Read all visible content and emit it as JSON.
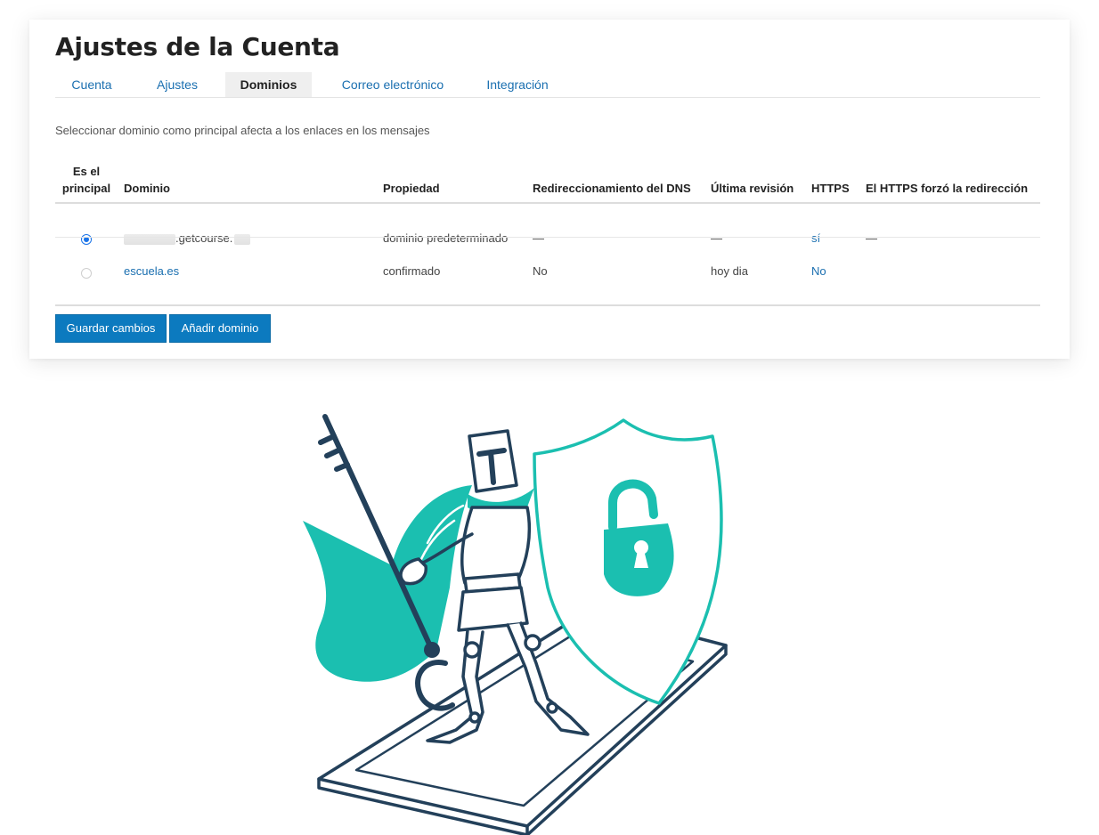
{
  "page": {
    "title": "Ajustes de la Cuenta"
  },
  "tabs": [
    {
      "label": "Cuenta",
      "active": false
    },
    {
      "label": "Ajustes",
      "active": false
    },
    {
      "label": "Dominios",
      "active": true
    },
    {
      "label": "Correo electrónico",
      "active": false
    },
    {
      "label": "Integración",
      "active": false
    }
  ],
  "description": "Seleccionar dominio como principal afecta a los enlaces en los mensajes",
  "table": {
    "headers": {
      "primary_line1": "Es el",
      "primary_line2": "principal",
      "domain": "Dominio",
      "property": "Propiedad",
      "dns": "Redireccionamiento del DNS",
      "last_check": "Última revisión",
      "https": "HTTPS",
      "https_forced": "El HTTPS forzó la redirección"
    },
    "rows": [
      {
        "primary": true,
        "domain": ".getcourse.",
        "property": "dominio predeterminado",
        "dns": "—",
        "last_check": "—",
        "https": "sí",
        "https_forced": "—"
      },
      {
        "primary": false,
        "domain": "escuela.es",
        "property": "confirmado",
        "dns": "No",
        "last_check": "hoy dia",
        "https": "No",
        "https_forced": ""
      }
    ]
  },
  "buttons": {
    "save": "Guardar cambios",
    "add": "Añadir dominio"
  },
  "colors": {
    "accent": "#0c7abf",
    "link": "#1a6fb0",
    "teal": "#1bbfb0",
    "navy": "#23405a"
  },
  "illustration": {
    "icons": [
      "knight-icon",
      "key-icon",
      "shield-icon",
      "padlock-icon",
      "cape-icon"
    ]
  }
}
